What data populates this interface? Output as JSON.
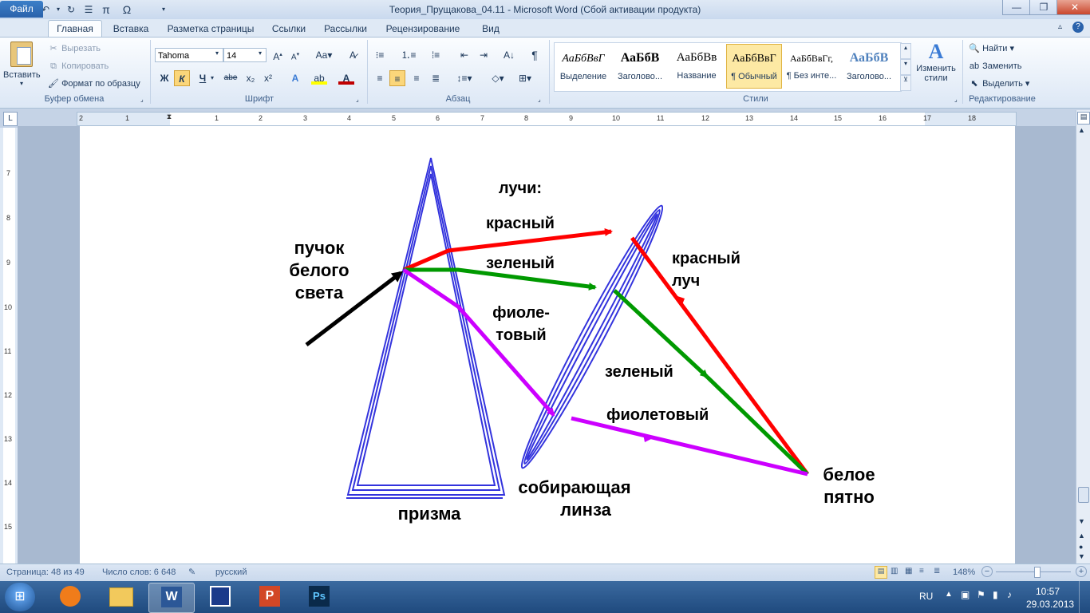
{
  "window": {
    "title": "Теория_Прущакова_04.11  -  Microsoft Word (Сбой активации продукта)",
    "minimize": "—",
    "maximize": "❐",
    "close": "✕"
  },
  "tabs": [
    "Файл",
    "Главная",
    "Вставка",
    "Разметка страницы",
    "Ссылки",
    "Рассылки",
    "Рецензирование",
    "Вид"
  ],
  "clipboard": {
    "paste": "Вставить",
    "cut": "Вырезать",
    "copy": "Копировать",
    "format_painter": "Формат по образцу",
    "label": "Буфер обмена"
  },
  "font": {
    "name": "Tahoma",
    "size": "14",
    "label": "Шрифт",
    "bold": "Ж",
    "italic": "К",
    "underline": "Ч",
    "strike": "abe",
    "sub": "x₂",
    "sup": "x²"
  },
  "paragraph": {
    "label": "Абзац",
    "pilcrow": "¶"
  },
  "styles": {
    "label": "Стили",
    "items": [
      {
        "sample": "АаБбВвГ",
        "name": "Выделение"
      },
      {
        "sample": "АаБбВ",
        "name": "Заголово..."
      },
      {
        "sample": "АаБбВв",
        "name": "Название"
      },
      {
        "sample": "АаБбВвГ",
        "name": "¶ Обычный"
      },
      {
        "sample": "АаБбВвГг,",
        "name": "¶ Без инте..."
      },
      {
        "sample": "АаБбВ",
        "name": "Заголово..."
      }
    ],
    "change": "Изменить стили"
  },
  "editing": {
    "find": "Найти",
    "replace": "Заменить",
    "select": "Выделить",
    "label": "Редактирование"
  },
  "ruler_numbers": [
    "2",
    "1",
    "1",
    "2",
    "3",
    "4",
    "5",
    "6",
    "7",
    "8",
    "9",
    "10",
    "11",
    "12",
    "13",
    "14",
    "15",
    "16",
    "17",
    "18"
  ],
  "vruler_numbers": [
    "7",
    "8",
    "9",
    "10",
    "11",
    "12",
    "13",
    "14",
    "15"
  ],
  "diagram": {
    "white_light": [
      "пучок",
      "белого",
      "света"
    ],
    "rays_title": "лучи:",
    "red": "красный",
    "green": "зеленый",
    "violet": [
      "фиоле-",
      "товый"
    ],
    "prism": "призма",
    "lens": [
      "собирающая",
      "линза"
    ],
    "red_ray": [
      "красный",
      "луч"
    ],
    "green2": "зеленый",
    "violet2": "фиолетовый",
    "white_spot": [
      "белое",
      "пятно"
    ]
  },
  "status": {
    "page": "Страница: 48 из 49",
    "words": "Число слов: 6 648",
    "lang": "русский",
    "zoom": "148%"
  },
  "taskbar": {
    "lang": "RU",
    "time": "10:57",
    "date": "29.03.2013"
  }
}
